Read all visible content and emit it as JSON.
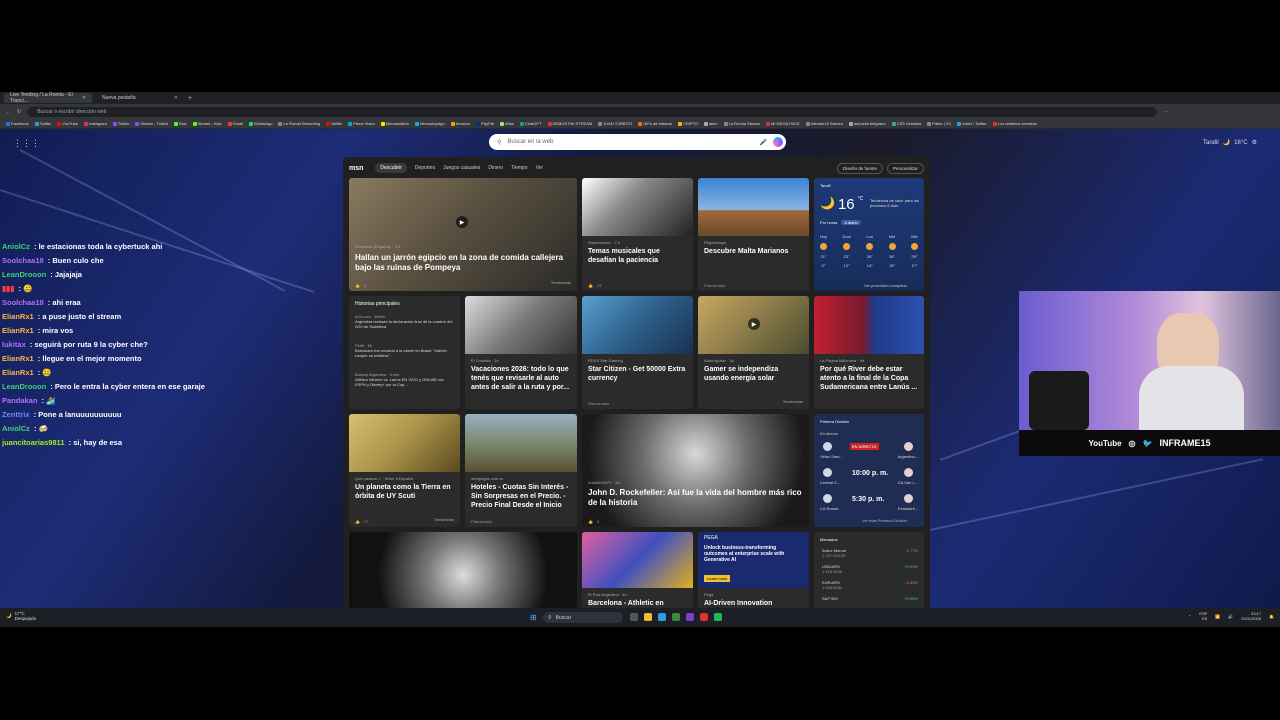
{
  "browser": {
    "tabs": [
      {
        "label": "Live Tending / La Ronda - El Tranci...",
        "active": true
      },
      {
        "label": "Nueva pestaña",
        "active": false
      }
    ],
    "address_placeholder": "Buscar o escribir dirección web",
    "bookmarks": [
      "Facebook",
      "Twitter",
      "YouTube",
      "Instagram",
      "Twitch",
      "Stream - Twitch",
      "Kick",
      "Stream - Kick",
      "Gmail",
      "WhatsApp",
      "La Ronda Streaming",
      "Netflix",
      "Prime Video",
      "Mercadolibre",
      "Mercadopago",
      "Amazon",
      "PayPal",
      "Wise",
      "ChatGPT",
      "DEMOS PAI STREAM",
      "JUAN TURBITO",
      "GIFs de Inframe",
      "CRIPTO",
      "alien",
      "La Ronda Stream",
      "MI MEGA PACK",
      "Inframe15 Stream",
      "depósito belgrano",
      "CSS Gradient",
      "Pablo | VC",
      "Inicio / Twitter",
      "Los obtienes secretos"
    ]
  },
  "desktop": {
    "search_placeholder": "Buscar en la web",
    "top_weather": {
      "city": "Tandil",
      "temp": "16°C"
    }
  },
  "msn": {
    "logo": "msn",
    "nav": [
      "Descubrir",
      "Deportes",
      "Juegos casuales",
      "Dinero",
      "Tiempo",
      "Ver"
    ],
    "nav_buttons": [
      "Diseño de fuente",
      "Personalizar"
    ],
    "cards": {
      "hero": {
        "source": "Euronews (Español) · 2 h",
        "title": "Hallan un jarrón egipcio en la zona de comida callejera bajo las ruinas de Pompeya",
        "reactions": "8",
        "tag": "Tendencias"
      },
      "temas": {
        "source": "Sharemaster · 2 h",
        "title": "Temas musicales que desafían la paciencia",
        "reactions": "23"
      },
      "malta": {
        "source": "PilgrimMaps",
        "title": "Descubre Malta Marianos",
        "foot": "Patrocinado"
      },
      "historias": {
        "header": "Historias principales",
        "items": [
          {
            "source": "A24.com · 46min",
            "text": "Argentina rechazó la declaración final de la cumbre del G20 de Sudáfrica"
          },
          {
            "source": "Perfil · 6h",
            "text": "Bolsonaro fue enviado a la cárcel en Brasil: \"Intentó romper su tobillera\"..."
          },
          {
            "source": "Bolavip Argentina · 4 min",
            "text": "Atlético Mineiro vs. Lanús EN VIVO y ONLINE vía ESPN y Disney+ por la Cop..."
          }
        ]
      },
      "vacaciones": {
        "source": "El Cronista · 2d",
        "title": "Vacaciones 2026: todo lo que tenés que revisarle al auto antes de salir a la ruta y por...",
        "foot": "Patrocinado"
      },
      "starcitizen": {
        "source": "RDSS Star Gaming",
        "title": "Star Citizen - Get 50000 Extra currency",
        "foot": "Patrocinado"
      },
      "gamer": {
        "source": "AbbeAguilar · 3d",
        "title": "Gamer se independiza usando energía solar",
        "tag": "Tendencias"
      },
      "river": {
        "source": "La Página Millonaria · 9h",
        "title": "Por qué River debe estar atento a la final de la Copa Sudamericana entre Lanús ..."
      },
      "planeta": {
        "source": "Qué pasada ☆ · Who! It Español",
        "title": "Un planeta como la Tierra en órbita de UY Scuti",
        "reactions": "17",
        "tag": "Tendencias"
      },
      "hoteles": {
        "source": "dempegas.com.ar",
        "title": "Hoteles - Cuotas Sin Interés - Sin Sorpresas en el Precio. - Precio Final Desde el Inicio",
        "foot": "Patrocinado"
      },
      "rockefeller": {
        "source": "InstAMONPY · 3d",
        "title": "John D. Rockefeller: Así fue la vida del hombre más rico de la historia",
        "reactions": "2"
      },
      "barcelona": {
        "source": "El País Argentina · 4h",
        "title": "Barcelona - Athletic en"
      },
      "pega": {
        "brand": "PEGA",
        "ad_text": "Unlock business-transforming outcomes at enterprise scale with Generative AI",
        "ad_button": "Learn more",
        "source": "Pega",
        "title": "AI-Driven Innovation"
      }
    },
    "weather": {
      "city": "Tandil",
      "temp": "16",
      "unit": "°C",
      "note": "Tendencia de calor para los próximos 6 días",
      "tabs": [
        "Por horas",
        "A diario"
      ],
      "days": [
        {
          "day": "Hoy",
          "hi": "21°",
          "lo": "0°"
        },
        {
          "day": "Dom",
          "hi": "23°",
          "lo": "12°"
        },
        {
          "day": "Lun",
          "hi": "26°",
          "lo": "14°"
        },
        {
          "day": "Mié",
          "hi": "28°",
          "lo": "15°"
        },
        {
          "day": "Mié",
          "hi": "29°",
          "lo": "17°"
        }
      ],
      "link": "Ver pronóstico completo"
    },
    "futbol": {
      "header": "Primera División",
      "live_label": "En directo",
      "matches": [
        {
          "home": "Vélez Sars...",
          "away": "Argentino...",
          "status": "EN DIRECTO"
        },
        {
          "home": "Central C...",
          "away": "CA San L...",
          "status": "10:00 p. m."
        },
        {
          "home": "CA Rosari...",
          "away": "Estudiant...",
          "status": "5:30 p. m."
        }
      ],
      "link": "Ver más Primera División"
    },
    "mercados": {
      "header": "Mercados",
      "rows": [
        {
          "name": "Índice Merval",
          "value": "2.787.244,99",
          "change": "-1,77%",
          "dir": "neg"
        },
        {
          "name": "USD/ARS",
          "value": "1.418,3025",
          "change": "+0,03%",
          "dir": "pos"
        },
        {
          "name": "EUR/ARS",
          "value": "1.636,6680",
          "change": "-0,32%",
          "dir": "neg"
        },
        {
          "name": "S&P 500",
          "value": "",
          "change": "+0,98%",
          "dir": "pos"
        }
      ]
    }
  },
  "chat": [
    {
      "user": "AniolCz",
      "color": "#3fd07a",
      "msg": "le estacionas toda la cybertuck ahi"
    },
    {
      "user": "Soolchaa18",
      "color": "#b86bff",
      "msg": "Buen culo che"
    },
    {
      "user": "LeanDrooon",
      "color": "#3fd07a",
      "msg": "Jajajaja"
    },
    {
      "user": "[sin nombre]",
      "color": "#ff3b3b",
      "msg": "🤐"
    },
    {
      "user": "Soolchaa18",
      "color": "#b86bff",
      "msg": "ahi eraa"
    },
    {
      "user": "ElianRx1",
      "color": "#ffb347",
      "msg": "a puse justo el stream"
    },
    {
      "user": "ElianRx1",
      "color": "#ffb347",
      "msg": "mira vos"
    },
    {
      "user": "lukitax",
      "color": "#b86bff",
      "msg": "seguirá por ruta 9 la cyber che?"
    },
    {
      "user": "ElianRx1",
      "color": "#ffb347",
      "msg": "llegue en el mejor momento"
    },
    {
      "user": "ElianRx1",
      "color": "#ffb347",
      "msg": "🤐"
    },
    {
      "user": "LeanDrooon",
      "color": "#3fd07a",
      "msg": "Pero le entra la cyber entera en ese garaje"
    },
    {
      "user": "Pandakan",
      "color": "#b86bff",
      "msg": "🏄"
    },
    {
      "user": "Zenttrix",
      "color": "#6b8cff",
      "msg": "Pone a lanuuuuuuuuuu"
    },
    {
      "user": "AniolCz",
      "color": "#3fd07a",
      "msg": "🍻"
    },
    {
      "user": "juancitoarias9811",
      "color": "#9ef01a",
      "msg": "si, hay de esa"
    }
  ],
  "cam": {
    "youtube": "YouTube",
    "handle": "INFRAME15"
  },
  "taskbar": {
    "weather": "17°C",
    "weather_desc": "Despejado",
    "search": "Buscar",
    "lang": "ESP",
    "lang2": "ES",
    "time": "23:17",
    "date": "22/11/2025"
  }
}
